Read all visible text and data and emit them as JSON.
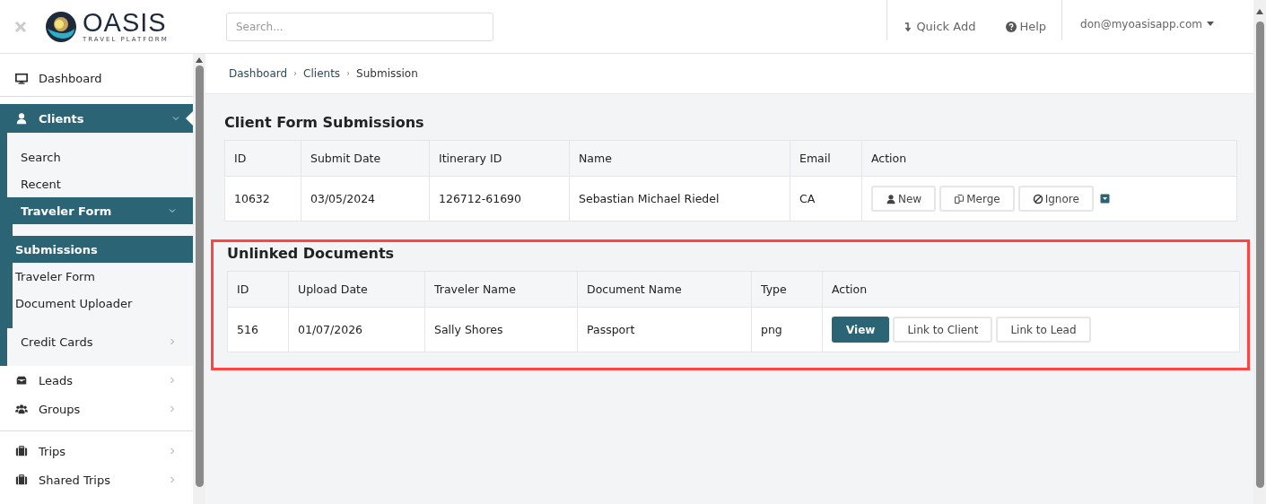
{
  "header": {
    "logo_title": "OASIS",
    "logo_subtitle": "TRAVEL PLATFORM",
    "search": {
      "placeholder": "Search..."
    },
    "quick_add": "Quick Add",
    "help": "Help",
    "user": "don@myoasisapp.com"
  },
  "sidebar": {
    "items": [
      {
        "label": "Dashboard",
        "kind": "link",
        "selected": false
      },
      {
        "label": "Clients",
        "kind": "group",
        "selected": true,
        "expanded": true,
        "children": [
          {
            "label": "Search",
            "kind": "link",
            "selected": false
          },
          {
            "label": "Recent",
            "kind": "link",
            "selected": false
          },
          {
            "label": "Traveler Form",
            "kind": "group",
            "selected": true,
            "expanded": true,
            "children": [
              {
                "label": "Submissions",
                "selected": true
              },
              {
                "label": "Traveler Form",
                "selected": false
              },
              {
                "label": "Document Uploader",
                "selected": false
              }
            ]
          },
          {
            "label": "Credit Cards",
            "kind": "group",
            "selected": false,
            "expanded": false
          }
        ]
      },
      {
        "label": "Leads",
        "kind": "group",
        "selected": false,
        "expanded": false
      },
      {
        "label": "Groups",
        "kind": "group",
        "selected": false,
        "expanded": false
      },
      {
        "label": "Trips",
        "kind": "group",
        "selected": false,
        "expanded": false
      },
      {
        "label": "Shared Trips",
        "kind": "group",
        "selected": false,
        "expanded": false
      }
    ]
  },
  "breadcrumb": [
    "Dashboard",
    "Clients",
    "Submission"
  ],
  "sections": [
    {
      "title": "Client Form Submissions",
      "highlighted": false,
      "columns": [
        "ID",
        "Submit Date",
        "Itinerary ID",
        "Name",
        "Email",
        "Action"
      ],
      "rows": [
        {
          "cells": [
            "10632",
            "03/05/2024",
            "126712-61690",
            "Sebastian Michael Riedel",
            "CA"
          ],
          "actions": [
            {
              "label": "New",
              "primary": false
            },
            {
              "label": "Merge",
              "primary": false
            },
            {
              "label": "Ignore",
              "primary": false
            }
          ],
          "dropdown": true
        }
      ]
    },
    {
      "title": "Unlinked Documents",
      "highlighted": true,
      "columns": [
        "ID",
        "Upload Date",
        "Traveler Name",
        "Document Name",
        "Type",
        "Action"
      ],
      "rows": [
        {
          "cells": [
            "516",
            "01/07/2026",
            "Sally Shores",
            "Passport",
            "png"
          ],
          "actions": [
            {
              "label": "View",
              "primary": true
            },
            {
              "label": "Link to Client",
              "primary": false
            },
            {
              "label": "Link to Lead",
              "primary": false
            }
          ],
          "dropdown": false
        }
      ]
    }
  ]
}
